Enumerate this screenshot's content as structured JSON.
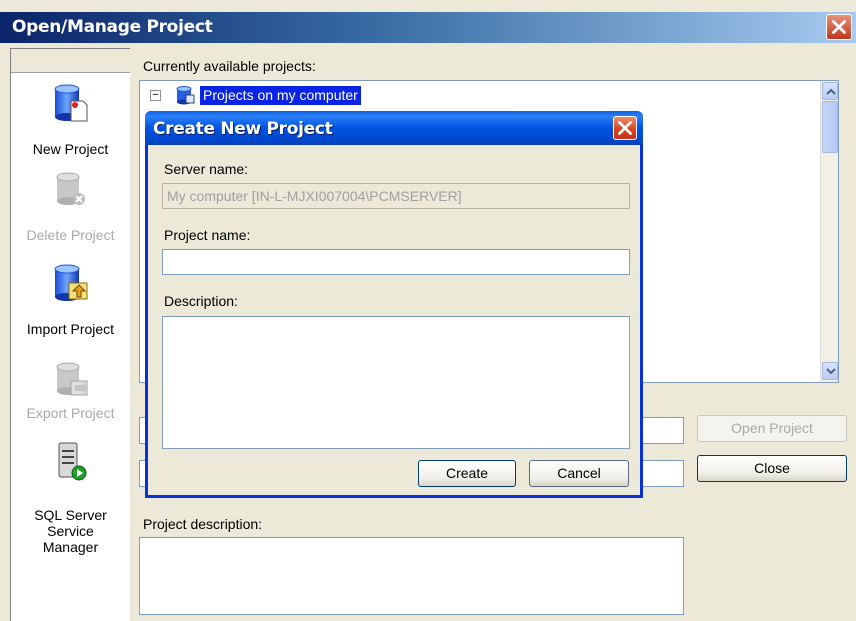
{
  "window": {
    "title": "Open/Manage Project"
  },
  "sidebar": {
    "tools": [
      {
        "label": "New Project",
        "icon": "new-project-icon",
        "enabled": true
      },
      {
        "label": "Delete Project",
        "icon": "delete-project-icon",
        "enabled": false
      },
      {
        "label": "Import Project",
        "icon": "import-project-icon",
        "enabled": true
      },
      {
        "label": "Export Project",
        "icon": "export-project-icon",
        "enabled": false
      },
      {
        "label": "SQL Server Service Manager",
        "icon": "sql-server-service-manager-icon",
        "enabled": true
      }
    ]
  },
  "main": {
    "available_label": "Currently available projects:",
    "tree_root": {
      "label": "Projects on my computer",
      "expander": "⊟"
    },
    "project_description_label": "Project description:",
    "open_button": "Open Project",
    "close_button": "Close"
  },
  "dialog": {
    "title": "Create New Project",
    "server_label": "Server name:",
    "server_value": "My computer [IN-L-MJXI007004\\PCMSERVER]",
    "project_label": "Project name:",
    "project_value": "",
    "description_label": "Description:",
    "description_value": "",
    "create_button": "Create",
    "cancel_button": "Cancel"
  },
  "colors": {
    "title_bar": "#0054e3",
    "selection": "#0a24e6",
    "face": "#ece9d8",
    "close_button": "#d9411c"
  }
}
